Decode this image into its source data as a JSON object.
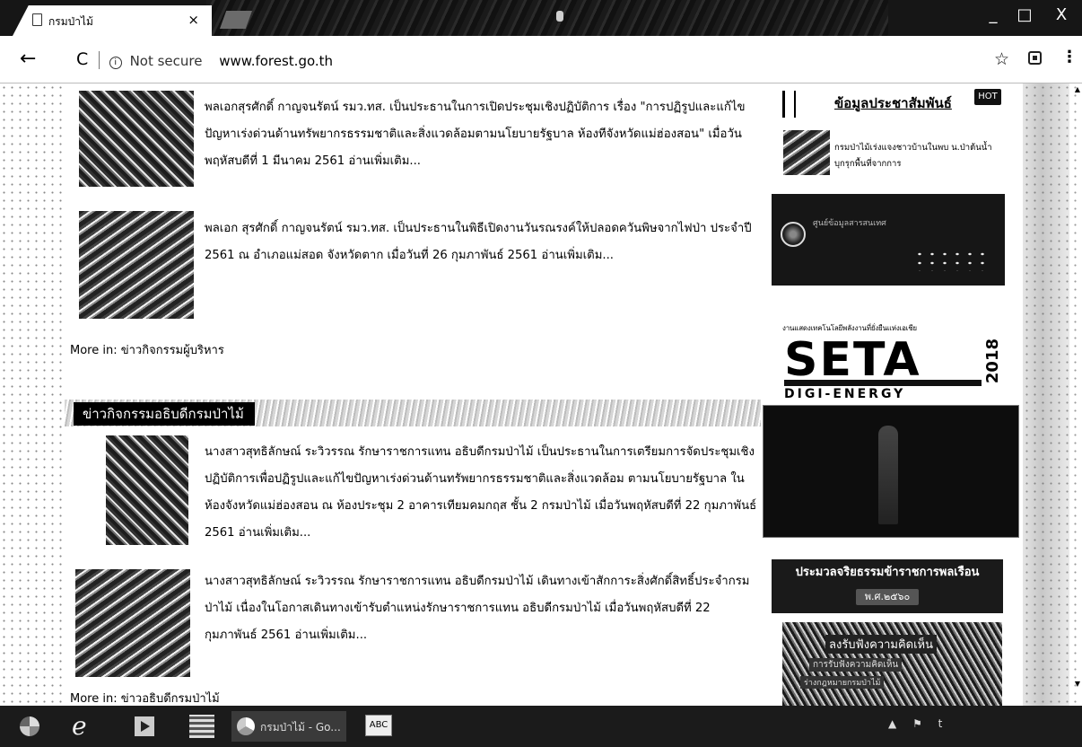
{
  "browser": {
    "tab_title": "กรมป่าไม้",
    "tab_close": "×",
    "back": "←",
    "reload": "C",
    "security": "Not secure",
    "info_glyph": "i",
    "url": "www.forest.go.th",
    "star": "☆",
    "menu": "⋮",
    "win_minimize": "_",
    "win_maximize": "□",
    "win_close": "X"
  },
  "executive_news": {
    "items": [
      {
        "text": "พลเอกสุรศักดิ์ กาญจนรัตน์ รมว.ทส. เป็นประธานในการเปิดประชุมเชิงปฏิบัติการ เรื่อง \"การปฏิรูปและแก้ไขปัญหาเร่งด่วนด้านทรัพยากรธรรมชาติและสิ่งแวดล้อมตามนโยบายรัฐบาล ห้องทีจังหวัดแม่ฮ่องสอน\" เมื่อวันพฤหัสบดีที่ 1 มีนาคม 2561",
        "more": "อ่านเพิ่มเติม..."
      },
      {
        "text": "พลเอก สุรศักดิ์ กาญจนรัตน์ รมว.ทส. เป็นประธานในพิธีเปิดงานวันรณรงค์ให้ปลอดควันพิษจากไฟป่า ประจำปี 2561 ณ อำเภอแม่สอด จังหวัดตาก เมื่อวันที่ 26 กุมภาพันธ์ 2561",
        "more": "อ่านเพิ่มเติม..."
      }
    ],
    "more_in_label": "More in:",
    "more_in_link": "ข่าวกิจกรรมผู้บริหาร"
  },
  "director_news": {
    "heading": "ข่าวกิจกรรมอธิบดีกรมป่าไม้",
    "items": [
      {
        "text": "นางสาวสุทธิลักษณ์ ระวิวรรณ รักษาราชการแทน อธิบดีกรมป่าไม้ เป็นประธานในการเตรียมการจัดประชุมเชิงปฏิบัติการเพื่อปฏิรูปและแก้ไขปัญหาเร่งด่วนด้านทรัพยากรธรรมชาติและสิ่งแวดล้อม ตามนโยบายรัฐบาล ในห้องจังหวัดแม่ฮ่องสอน ณ ห้องประชุม 2 อาคารเทียมคมกฤส ชั้น 2 กรมป่าไม้ เมื่อวันพฤหัสบดีที่ 22 กุมภาพันธ์ 2561",
        "more": "อ่านเพิ่มเติม..."
      },
      {
        "text": "นางสาวสุทธิลักษณ์ ระวิวรรณ รักษาราชการแทน อธิบดีกรมป่าไม้ เดินทางเข้าสักการะสิ่งศักดิ์สิทธิ์ประจำกรมป่าไม้ เนื่องในโอกาสเดินทางเข้ารับตำแหน่งรักษาราชการแทน อธิบดีกรมป่าไม้ เมื่อวันพฤหัสบดีที่ 22 กุมภาพันธ์ 2561",
        "more": "อ่านเพิ่มเติม..."
      }
    ],
    "more_in_label": "More in:",
    "more_in_link": "ข่าวอธิบดีกรมป่าไม้"
  },
  "sidebar": {
    "title": "ข้อมูลประชาสัมพันธ์",
    "hot_badge": "HOT",
    "item": "กรมป่าไม้เร่งแจงชาวบ้านในพบ น.ป่าต้นน้ำบุกรุกพื้นที่จากการ",
    "banner1_title": "ศูนย์ข้อมูลสารสนเทศ",
    "banner2_sup": "งานแสดงเทคโนโลยีพลังงานที่ยั่งยืนแห่งเอเชีย",
    "banner2_logo": "SETA",
    "banner2_year": "2018",
    "banner2_sub": "DIGI-ENERGY",
    "banner4_title": "ประมวลจริยธรรมข้าราชการพลเรือน",
    "banner4_sub": "พ.ศ.๒๕๖๐",
    "banner5_line1": "ลงรับฟังความคิดเห็น",
    "banner5_line2": "การรับฟังความคิดเห็น",
    "banner5_line3": "ร่างกฎหมายกรมป่าไม้"
  },
  "taskbar": {
    "ie_glyph": "e",
    "chrome_label": "กรมป่าไม้ - Go...",
    "abc_label": "ABC",
    "tray_up": "▲",
    "tray_flag": "⚑",
    "tray_time": "t"
  }
}
